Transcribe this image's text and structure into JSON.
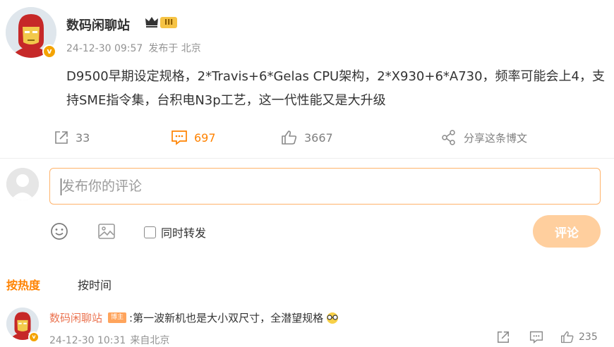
{
  "post": {
    "author": "数码闲聊站",
    "verified_badge": "v",
    "level_badge": "III",
    "timestamp": "24-12-30 09:57",
    "source": "发布于 北京",
    "text": "D9500早期设定规格，2*Travis+6*Gelas CPU架构，2*X930+6*A730，频率可能会上4，支持SME指令集，台积电N3p工艺，这一代性能又是大升级"
  },
  "actions": {
    "repost_count": "33",
    "comment_count": "697",
    "like_count": "3667",
    "share_label": "分享这条博文"
  },
  "composer": {
    "placeholder": "发布你的评论",
    "repost_option": "同时转发",
    "submit_label": "评论"
  },
  "sort": {
    "hot_label": "按热度",
    "time_label": "按时间"
  },
  "comment": {
    "author": "数码闲聊站",
    "tag": "博主",
    "text": ":第一波新机也是大小双尺寸，全潜望规格",
    "timestamp": "24-12-30 10:31",
    "location": "来自北京",
    "like_count": "235"
  },
  "icons": {
    "repost": "repost-icon",
    "comment": "comment-icon",
    "like": "like-icon",
    "share": "share-icon",
    "emoji": "emoji-icon",
    "image": "image-icon"
  },
  "colors": {
    "accent": "#ff8200",
    "name_link": "#eb7350",
    "submit_disabled": "#ffcf9e",
    "input_border": "#ffb36b",
    "meta": "#939393"
  }
}
